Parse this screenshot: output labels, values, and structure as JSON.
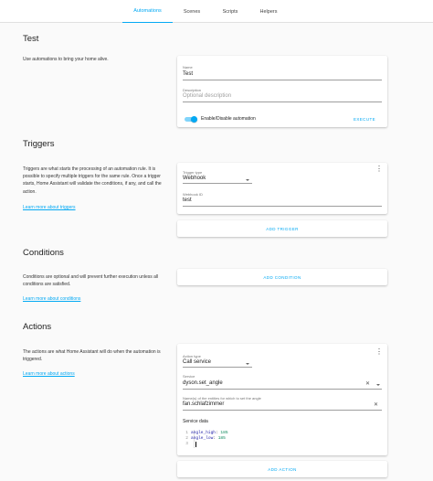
{
  "tabs": [
    {
      "label": "Automations",
      "active": true
    },
    {
      "label": "Scenes",
      "active": false
    },
    {
      "label": "Scripts",
      "active": false
    },
    {
      "label": "Helpers",
      "active": false
    }
  ],
  "accent_color": "#03a9f4",
  "test_section": {
    "title": "Test",
    "description": "Use automations to bring your home alive.",
    "name_label": "Name",
    "name_value": "Test",
    "description_label": "Description",
    "description_placeholder": "Optional description",
    "toggle_label": "Enable/Disable automation",
    "toggle_enabled": true,
    "execute_label": "EXECUTE"
  },
  "triggers": {
    "title": "Triggers",
    "description": "Triggers are what starts the processing of an automation rule. It is possible to specify multiple triggers for the same rule. Once a trigger starts, Home Assistant will validate the conditions, if any, and call the action.",
    "learn_more": "Learn more about triggers",
    "type_label": "Trigger type",
    "type_value": "Webhook",
    "webhook_label": "Webhook ID",
    "webhook_value": "test",
    "add_label": "ADD TRIGGER",
    "menu_icon": "more-vert-icon"
  },
  "conditions": {
    "title": "Conditions",
    "description": "Conditions are optional and will prevent further execution unless all conditions are satisfied.",
    "learn_more": "Learn more about conditions",
    "add_label": "ADD CONDITION"
  },
  "actions": {
    "title": "Actions",
    "description": "The actions are what Home Assistant will do when the automation is triggered.",
    "learn_more": "Learn more about actions",
    "type_label": "Action type",
    "type_value": "Call service",
    "service_label": "Service",
    "service_value": "dyson.set_angle",
    "entities_label": "Name(s) of the entities for which to set the angle",
    "entities_value": "fan.schlafzimmer",
    "service_data_label": "Service data",
    "code_lines": [
      {
        "num": "1",
        "key": "angle_high",
        "value": "185"
      },
      {
        "num": "2",
        "key": "angle_low",
        "value": "185"
      },
      {
        "num": "3",
        "key": "",
        "value": ""
      }
    ],
    "add_label": "ADD ACTION",
    "menu_icon": "more-vert-icon"
  }
}
